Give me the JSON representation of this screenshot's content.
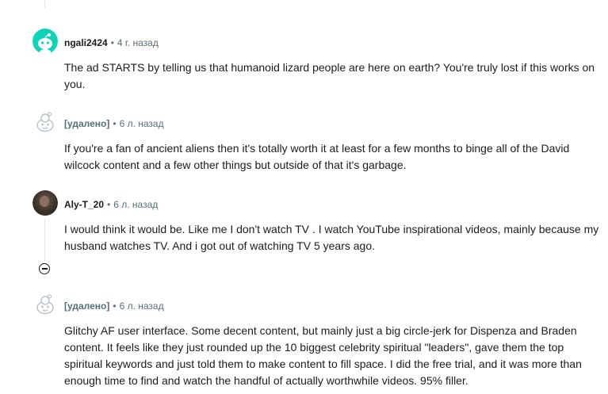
{
  "comments": [
    {
      "author": "ngali2424",
      "time": "4 г. назад",
      "text": "The ad STARTS by telling us that humanoid lizard people are here on earth? You're truly lost if this works on you.",
      "avatar_icon": "snoo-avatar-icon"
    },
    {
      "author": "[удалено]",
      "time": "6 л. назад",
      "text": "If you're a fan of ancient aliens then it's totally worth it at least for a few months to binge all of the David wilcock content and a few other things but outside of that it's garbage.",
      "avatar_icon": "deleted-user-avatar-icon"
    },
    {
      "author": "Aly-T_20",
      "time": "6 л. назад",
      "text": "I would think it would be. Like me I don't watch TV . I watch YouTube inspirational videos, mainly because my husband watches TV. And i got out of watching TV 5 years ago.",
      "avatar_icon": "user-photo-avatar-icon"
    },
    {
      "author": "[удалено]",
      "time": "6 л. назад",
      "text": "Glitchy AF user interface. Some decent content, but mainly just a big circle-jerk for Dispenza and Braden content. It feels like they just rounded up the 10 biggest celebrity spiritual \"leaders\", gave them the top spiritual keywords and just told them to make content to fill space. I did the free trial, and it was more than enough time to find and watch the handful of actually worthwhile videos. 95% filler.",
      "avatar_icon": "deleted-user-avatar-icon"
    }
  ],
  "separator": "•",
  "colors": {
    "teal_avatar": "#0dd3bb",
    "meta_text": "#576f76",
    "thread_line": "#e5e5e5"
  }
}
